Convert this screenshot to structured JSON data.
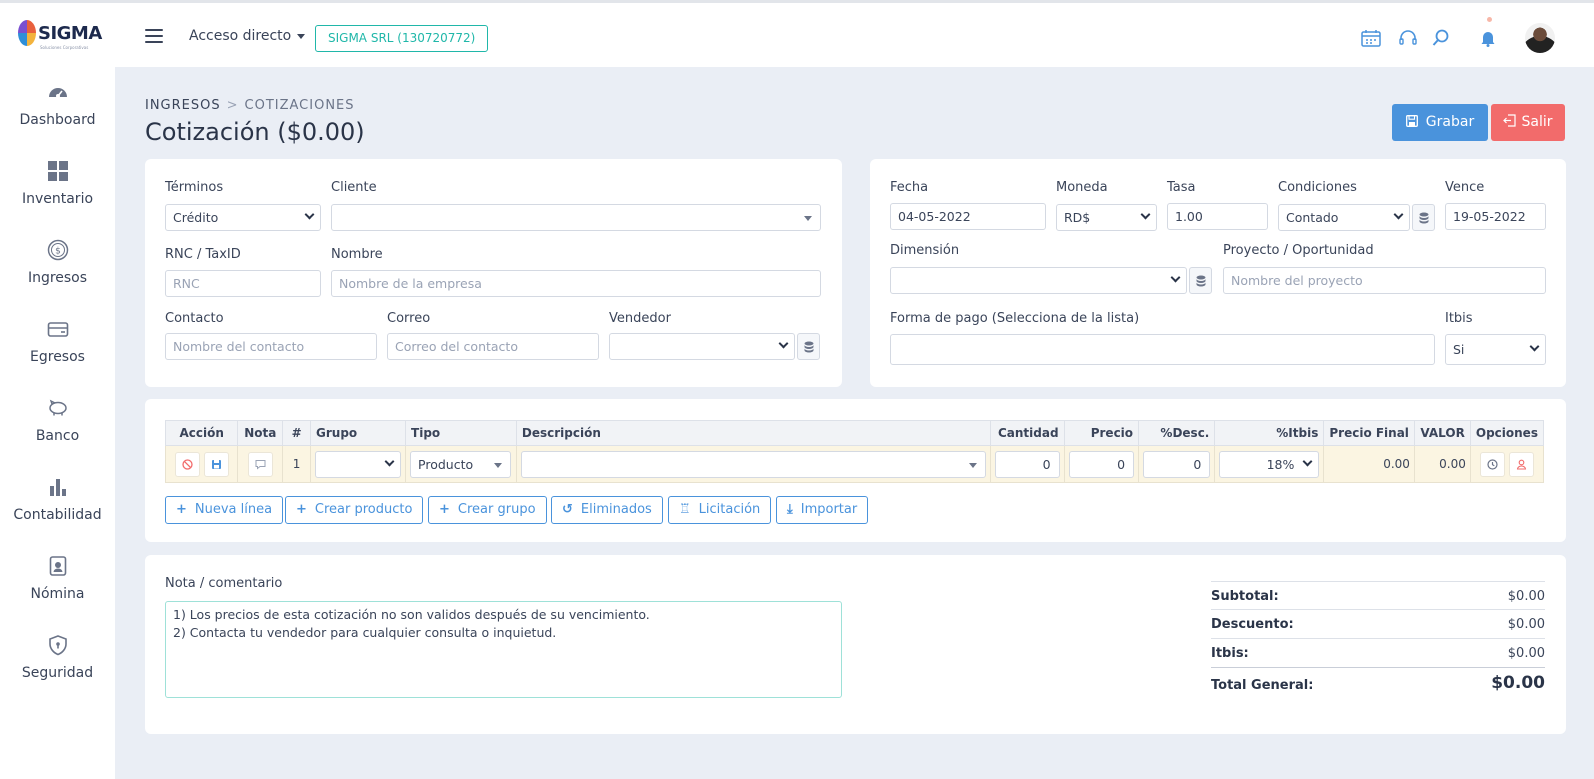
{
  "app": {
    "logo_text": "SIGMA",
    "logo_subtitle": "Soluciones Corporativas",
    "quick_access": "Acceso directo",
    "company": "SIGMA SRL (130720772)"
  },
  "sidebar": {
    "items": [
      {
        "label": "Dashboard",
        "icon": "gauge-icon"
      },
      {
        "label": "Inventario",
        "icon": "grid-icon"
      },
      {
        "label": "Ingresos",
        "icon": "dollar-icon"
      },
      {
        "label": "Egresos",
        "icon": "card-icon"
      },
      {
        "label": "Banco",
        "icon": "piggy-bank-icon"
      },
      {
        "label": "Contabilidad",
        "icon": "bar-chart-icon"
      },
      {
        "label": "Nómina",
        "icon": "badge-icon"
      },
      {
        "label": "Seguridad",
        "icon": "shield-icon"
      }
    ]
  },
  "header": {
    "breadcrumb": [
      "INGRESOS",
      "COTIZACIONES"
    ],
    "title": "Cotización ($0.00)",
    "save_label": "Grabar",
    "exit_label": "Salir"
  },
  "client_form": {
    "terminos_label": "Términos",
    "terminos_value": "Crédito",
    "cliente_label": "Cliente",
    "cliente_value": "",
    "rnc_label": "RNC / TaxID",
    "rnc_placeholder": "RNC",
    "nombre_label": "Nombre",
    "nombre_placeholder": "Nombre de la empresa",
    "contacto_label": "Contacto",
    "contacto_placeholder": "Nombre del contacto",
    "correo_label": "Correo",
    "correo_placeholder": "Correo del contacto",
    "vendedor_label": "Vendedor",
    "vendedor_value": ""
  },
  "doc_form": {
    "fecha_label": "Fecha",
    "fecha_value": "04-05-2022",
    "moneda_label": "Moneda",
    "moneda_value": "RD$",
    "tasa_label": "Tasa",
    "tasa_value": "1.00",
    "condiciones_label": "Condiciones",
    "condiciones_value": "Contado",
    "vence_label": "Vence",
    "vence_value": "19-05-2022",
    "dimension_label": "Dimensión",
    "dimension_value": "",
    "proyecto_label": "Proyecto / Oportunidad",
    "proyecto_placeholder": "Nombre del proyecto",
    "forma_pago_label": "Forma de pago (Selecciona de la lista)",
    "forma_pago_value": "",
    "itbis_label": "Itbis",
    "itbis_value": "Si"
  },
  "lines_table": {
    "columns": [
      "Acción",
      "Nota",
      "#",
      "Grupo",
      "Tipo",
      "Descripción",
      "Cantidad",
      "Precio",
      "%Desc.",
      "%Itbis",
      "Precio Final",
      "VALOR",
      "Opciones"
    ],
    "rows": [
      {
        "num": "1",
        "grupo": "",
        "tipo": "Producto",
        "descripcion": "",
        "cantidad": "0",
        "precio": "0",
        "desc": "0",
        "itbis": "18%",
        "precio_final": "0.00",
        "valor": "0.00"
      }
    ]
  },
  "line_actions": {
    "nueva_linea": "Nueva línea",
    "crear_producto": "Crear producto",
    "crear_grupo": "Crear grupo",
    "eliminados": "Eliminados",
    "licitacion": "Licitación",
    "importar": "Importar"
  },
  "notes": {
    "label": "Nota / comentario",
    "line1": "1) Los precios de esta cotización no son validos después de su vencimiento.",
    "line2": "2) Contacta tu vendedor para cualquier consulta o inquietud."
  },
  "totals": {
    "subtotal_label": "Subtotal:",
    "subtotal": "$0.00",
    "descuento_label": "Descuento:",
    "descuento": "$0.00",
    "itbis_label": "Itbis:",
    "itbis": "$0.00",
    "total_label": "Total General:",
    "total": "$0.00"
  },
  "colors": {
    "primary": "#4a93dc",
    "danger": "#f26b6b",
    "teal": "#20b7a9",
    "background": "#eaeef5",
    "row_highlight": "#fbf5e2"
  }
}
